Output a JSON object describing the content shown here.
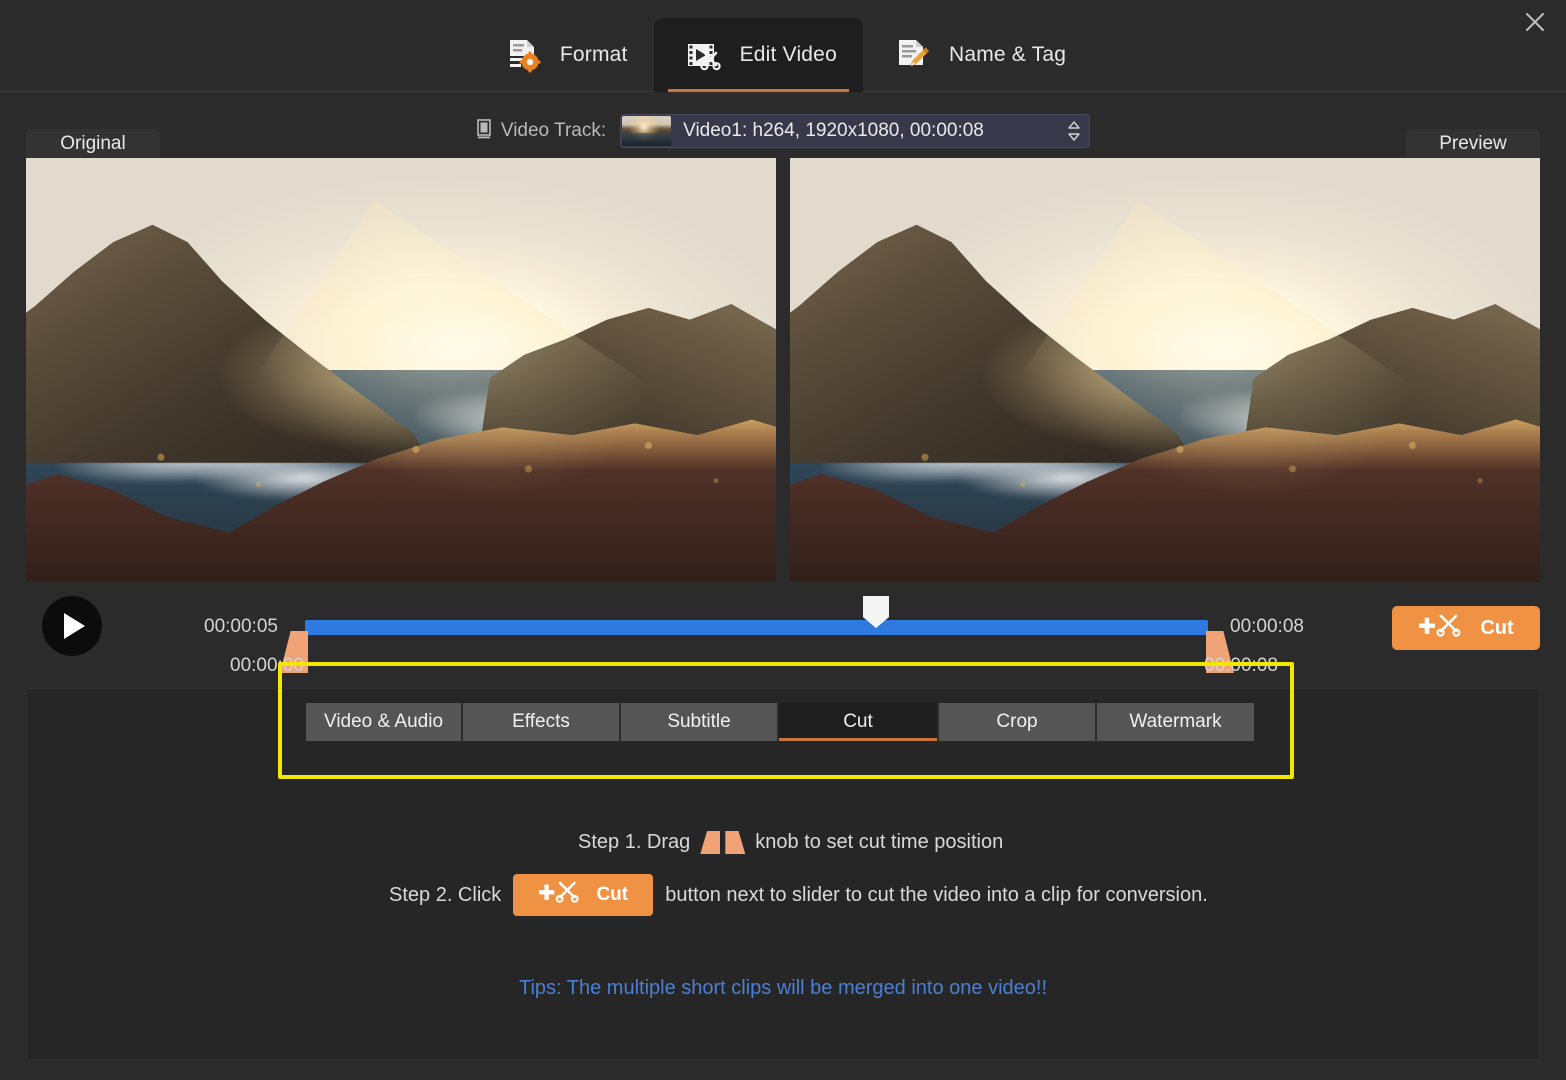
{
  "window": {
    "close_icon": "close-icon"
  },
  "main_tabs": [
    {
      "label": "Format",
      "icon": "format-icon",
      "active": false
    },
    {
      "label": "Edit Video",
      "icon": "edit-video-icon",
      "active": true
    },
    {
      "label": "Name & Tag",
      "icon": "name-tag-icon",
      "active": false
    }
  ],
  "track": {
    "label": "Video Track:",
    "track_icon": "video-track-icon",
    "selected": "Video1: h264, 1920x1080, 00:00:08",
    "dropdown_icon": "updown-chevron-icon",
    "thumbnail": "video-thumbnail"
  },
  "panes": {
    "original_label": "Original",
    "preview_label": "Preview"
  },
  "timeline": {
    "play_icon": "play-icon",
    "start_time": "00:00:05",
    "end_time": "00:00:08",
    "track_start": "00:00:00",
    "track_end": "00:00:08",
    "cut_button": "Cut",
    "cut_icon": "add-scissors-icon",
    "playhead": "playhead-marker"
  },
  "sub_tabs": [
    {
      "label": "Video & Audio",
      "active": false
    },
    {
      "label": "Effects",
      "active": false
    },
    {
      "label": "Subtitle",
      "active": false
    },
    {
      "label": "Cut",
      "active": true
    },
    {
      "label": "Crop",
      "active": false
    },
    {
      "label": "Watermark",
      "active": false
    }
  ],
  "instructions": {
    "step1_prefix": "Step 1. Drag",
    "step1_suffix": "knob to set cut time position",
    "step2_prefix": "Step 2. Click",
    "step2_button": "Cut",
    "step2_suffix": "button next to slider to cut the video into a clip for conversion.",
    "tips": "Tips: The multiple short clips will be merged into one video!!"
  },
  "colors": {
    "accent_orange": "#ef9244",
    "tab_underline": "#c8743a",
    "slider_blue": "#2f7ae0",
    "knob_peach": "#f0a377",
    "highlight_yellow": "#f3e600",
    "tips_blue": "#4a7fd6",
    "window_bg": "#2b2b2b",
    "panel_bg": "#262626"
  }
}
